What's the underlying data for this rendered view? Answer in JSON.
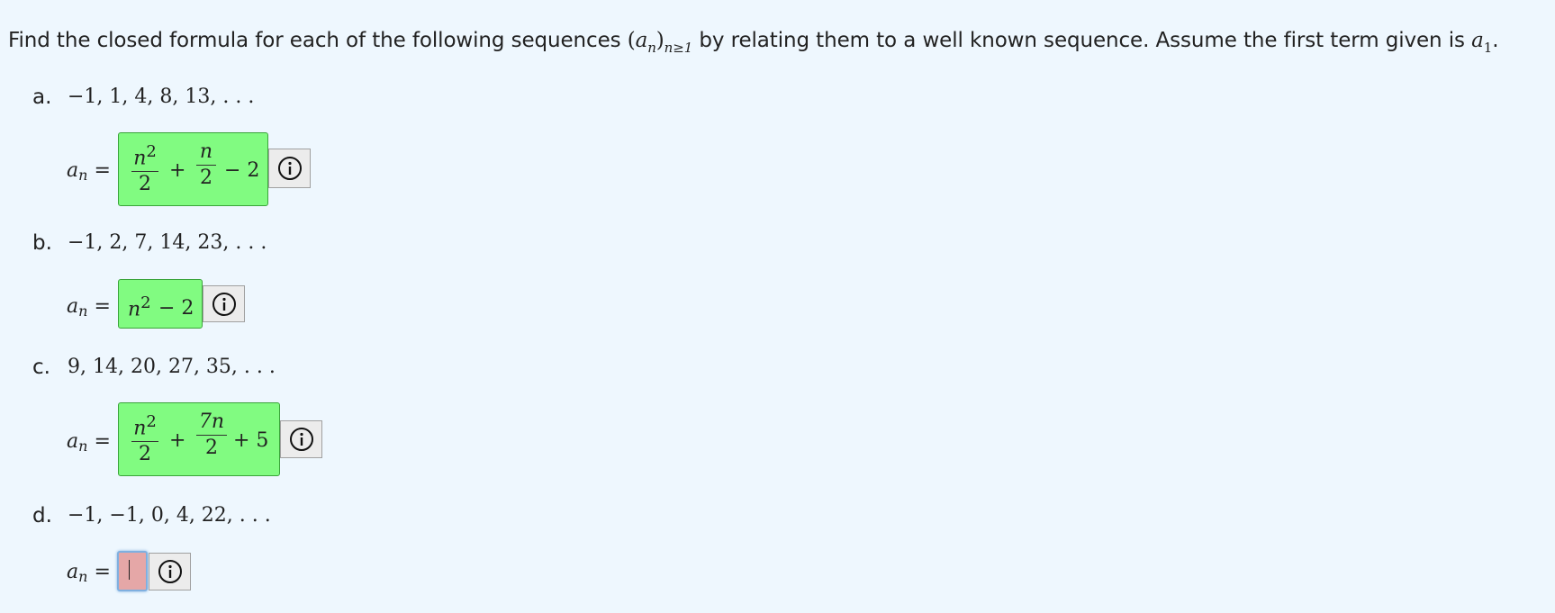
{
  "prompt": {
    "text_before": "Find the closed formula for each of the following sequences ",
    "seq_open": "(",
    "seq_var": "a",
    "seq_var_sub": "n",
    "seq_close": ")",
    "seq_index": "n≥1",
    "text_middle": " by relating them to a well known sequence. Assume the first term given is ",
    "first_term": "a",
    "first_term_sub": "1",
    "text_end": "."
  },
  "lhs": {
    "var": "a",
    "sub": "n",
    "eq": "="
  },
  "parts": [
    {
      "label": "a.",
      "sequence": "−1, 1, 4, 8, 13, . . .",
      "answer": {
        "frac1_num": "n",
        "frac1_exp": "2",
        "frac1_den": "2",
        "op1": "+",
        "frac2_num": "n",
        "frac2_den": "2",
        "tail": "− 2"
      },
      "status": "correct"
    },
    {
      "label": "b.",
      "sequence": "−1, 2, 7, 14, 23, . . .",
      "answer": {
        "base": "n",
        "exp": "2",
        "tail": "− 2"
      },
      "status": "correct"
    },
    {
      "label": "c.",
      "sequence": "9, 14, 20, 27, 35, . . .",
      "answer": {
        "frac1_num": "n",
        "frac1_exp": "2",
        "frac1_den": "2",
        "op1": "+",
        "frac2_num": "7n",
        "frac2_den": "2",
        "tail": "+ 5"
      },
      "status": "correct"
    },
    {
      "label": "d.",
      "sequence": "−1, −1, 0, 4, 22, . . .",
      "answer": {
        "value": ""
      },
      "status": "empty"
    }
  ],
  "icons": {
    "info": "info-circle-icon"
  },
  "colors": {
    "correct_bg": "#81fb81",
    "empty_bg": "#e5a7a7",
    "page_bg": "#eef7fe",
    "focus_border": "#7fb0e0"
  }
}
